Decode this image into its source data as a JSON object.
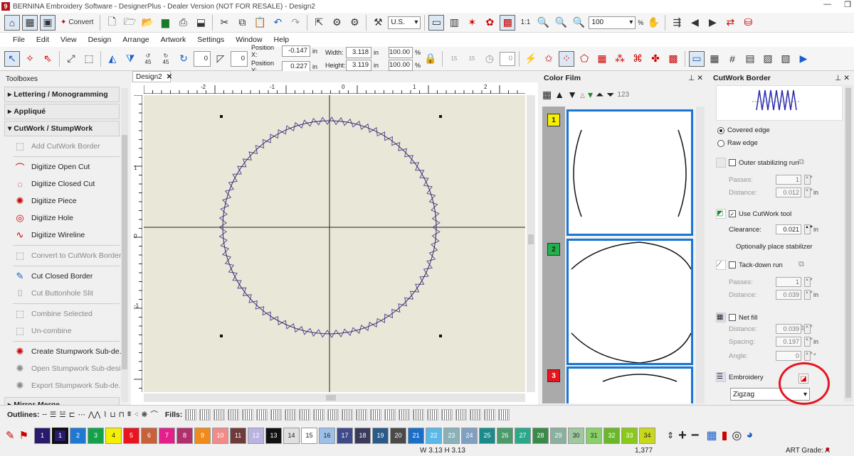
{
  "window": {
    "title": "BERNINA Embroidery Software - DesignerPlus - Dealer Version (NOT FOR RESALE) - Design2",
    "logo_letter": "9"
  },
  "toolbar1": {
    "convert_label": "Convert",
    "units_value": "U.S.",
    "zoom_value": "100",
    "zoom_unit": "%"
  },
  "menu": [
    "File",
    "Edit",
    "View",
    "Design",
    "Arrange",
    "Artwork",
    "Settings",
    "Window",
    "Help"
  ],
  "toolbar2": {
    "rotate_value": "0",
    "rotate2_value": "0",
    "pos_x_label": "Position X:",
    "pos_x_value": "-0.147",
    "pos_x_unit": "in",
    "pos_y_label": "Position Y:",
    "pos_y_value": "0.227",
    "pos_y_unit": "in",
    "width_label": "Width:",
    "width_value": "3.118",
    "width_unit": "in",
    "height_label": "Height:",
    "height_value": "3.119",
    "height_unit": "in",
    "scale_w": "100.00",
    "scale_h": "100.00",
    "pct": "%",
    "rot45a": "45",
    "rot45b": "45",
    "rot15a": "15",
    "rot15b": "15",
    "misc_value": "0"
  },
  "toolboxes": {
    "title": "Toolboxes",
    "sections": {
      "lettering": "Lettering / Monogramming",
      "applique": "Appliqué",
      "cutwork": "CutWork / StumpWork",
      "mirror": "Mirror-Merge"
    },
    "tools": [
      {
        "label": "Add CutWork Border",
        "icon": "add-border-icon"
      },
      {
        "label": "Digitize Open Cut",
        "icon": "open-cut-icon"
      },
      {
        "label": "Digitize Closed Cut",
        "icon": "closed-cut-icon"
      },
      {
        "label": "Digitize Piece",
        "icon": "piece-icon"
      },
      {
        "label": "Digitize Hole",
        "icon": "hole-icon"
      },
      {
        "label": "Digitize Wireline",
        "icon": "wireline-icon"
      },
      {
        "label": "Convert to CutWork Border",
        "icon": "convert-border-icon"
      },
      {
        "label": "Cut Closed Border",
        "icon": "cut-closed-border-icon"
      },
      {
        "label": "Cut Buttonhole Slit",
        "icon": "buttonhole-icon"
      },
      {
        "label": "Combine Selected",
        "icon": "combine-icon"
      },
      {
        "label": "Un-combine",
        "icon": "uncombine-icon"
      },
      {
        "label": "Create Stumpwork Sub-de...",
        "icon": "create-stumpwork-icon"
      },
      {
        "label": "Open Stumpwork Sub-desi...",
        "icon": "open-stumpwork-icon"
      },
      {
        "label": "Export Stumpwork Sub-de...",
        "icon": "export-stumpwork-icon"
      }
    ]
  },
  "document": {
    "tab_label": "Design2",
    "ruler_labels": [
      "-2",
      "-1",
      "0",
      "1",
      "2"
    ],
    "vruler_labels": [
      "1",
      "0",
      "-1"
    ]
  },
  "color_film": {
    "title": "Color Film",
    "numbers_label": "123",
    "spools": [
      {
        "n": "1",
        "color": "#f5f000"
      },
      {
        "n": "2",
        "color": "#22b14c"
      },
      {
        "n": "3",
        "color": "#e8141e"
      }
    ]
  },
  "cutwork_border": {
    "title": "CutWork Border",
    "covered_edge": "Covered edge",
    "raw_edge": "Raw edge",
    "outer_stab": "Outer stabilizing run",
    "passes_label": "Passes:",
    "passes_value": "1",
    "distance_label": "Distance:",
    "distance_value": "0.012",
    "use_cutwork": "Use CutWork tool",
    "clearance_label": "Clearance:",
    "clearance_value": "0.021",
    "optional": "Optionally place stabilizer",
    "tackdown": "Tack-down run",
    "td_passes_value": "1",
    "td_distance_value": "0.039",
    "net_fill": "Net fill",
    "nf_distance_value": "0.039",
    "spacing_label": "Spacing:",
    "spacing_value": "0.197",
    "angle_label": "Angle:",
    "angle_value": "0",
    "deg": "°",
    "embroidery": "Embroidery",
    "stitch_type": "Zigzag",
    "unit": "in",
    "highlight_color": "#e8141e"
  },
  "bottom_bar": {
    "outlines_label": "Outlines:",
    "fills_label": "Fills:"
  },
  "palette": [
    {
      "n": "1",
      "c": "#2a1a6e",
      "fg": "#fff"
    },
    {
      "n": "1",
      "c": "#2a1a6e",
      "fg": "#fff",
      "selected": true
    },
    {
      "n": "2",
      "c": "#1f78d1",
      "fg": "#fff"
    },
    {
      "n": "3",
      "c": "#14a14a",
      "fg": "#fff"
    },
    {
      "n": "4",
      "c": "#f5f000",
      "fg": "#222"
    },
    {
      "n": "5",
      "c": "#e8141e",
      "fg": "#fff"
    },
    {
      "n": "6",
      "c": "#c8603a",
      "fg": "#fff"
    },
    {
      "n": "7",
      "c": "#e21f8a",
      "fg": "#fff"
    },
    {
      "n": "8",
      "c": "#b0306e",
      "fg": "#fff"
    },
    {
      "n": "9",
      "c": "#f08a1a",
      "fg": "#fff"
    },
    {
      "n": "10",
      "c": "#f28a8a",
      "fg": "#fff"
    },
    {
      "n": "11",
      "c": "#6e3a3a",
      "fg": "#fff"
    },
    {
      "n": "12",
      "c": "#b9b3e0",
      "fg": "#fff"
    },
    {
      "n": "13",
      "c": "#111111",
      "fg": "#fff"
    },
    {
      "n": "14",
      "c": "#e0e0e0",
      "fg": "#222"
    },
    {
      "n": "15",
      "c": "#ffffff",
      "fg": "#222"
    },
    {
      "n": "16",
      "c": "#9ec0e8",
      "fg": "#222"
    },
    {
      "n": "17",
      "c": "#3f4a8a",
      "fg": "#fff"
    },
    {
      "n": "18",
      "c": "#3a3a5a",
      "fg": "#fff"
    },
    {
      "n": "19",
      "c": "#2a5a8a",
      "fg": "#fff"
    },
    {
      "n": "20",
      "c": "#4a4a4a",
      "fg": "#fff"
    },
    {
      "n": "21",
      "c": "#1a6ec8",
      "fg": "#fff"
    },
    {
      "n": "22",
      "c": "#5ab8e8",
      "fg": "#fff"
    },
    {
      "n": "23",
      "c": "#8ab0b8",
      "fg": "#fff"
    },
    {
      "n": "24",
      "c": "#7fa0c0",
      "fg": "#fff"
    },
    {
      "n": "25",
      "c": "#1a8a8a",
      "fg": "#fff"
    },
    {
      "n": "26",
      "c": "#4a9a6a",
      "fg": "#fff"
    },
    {
      "n": "27",
      "c": "#2aa88a",
      "fg": "#fff"
    },
    {
      "n": "28",
      "c": "#3a8a4a",
      "fg": "#fff"
    },
    {
      "n": "29",
      "c": "#8ab0a0",
      "fg": "#fff"
    },
    {
      "n": "30",
      "c": "#a0c8a0",
      "fg": "#222"
    },
    {
      "n": "31",
      "c": "#8ad06a",
      "fg": "#222"
    },
    {
      "n": "32",
      "c": "#6ab82a",
      "fg": "#fff"
    },
    {
      "n": "33",
      "c": "#8ac81a",
      "fg": "#fff"
    },
    {
      "n": "34",
      "c": "#c8d81a",
      "fg": "#222"
    }
  ],
  "status": {
    "size": "W 3.13 H 3.13",
    "stitches": "1,377",
    "grade": "ART Grade: A"
  }
}
